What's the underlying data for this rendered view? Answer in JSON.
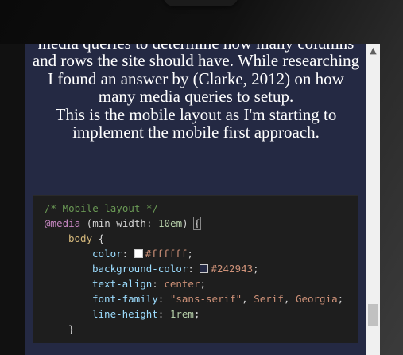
{
  "article": {
    "paragraph_1": "media queries to determine how many columns and rows the site should have. While researching I found an answer by (Clarke, 2012) on how many media queries to setup.",
    "paragraph_2": "This is the mobile layout as I'm starting to implement the mobile first approach."
  },
  "code": {
    "comment": "/* Mobile layout */",
    "at_rule": "@media",
    "condition_open": " (min-width: ",
    "min_width": "10em",
    "condition_close": ") ",
    "brace_open": "{",
    "selector": "body",
    "selector_brace": " {",
    "color_prop": "color",
    "color_value": "#ffffff",
    "color_swatch": "#ffffff",
    "bg_prop": "background-color",
    "bg_value": "#242943",
    "bg_swatch": "#242943",
    "align_prop": "text-align",
    "align_value": "center",
    "font_prop": "font-family",
    "font_value_1": "\"sans-serif\"",
    "font_value_2": "Serif",
    "font_value_3": "Georgia",
    "lh_prop": "line-height",
    "lh_value": "1rem",
    "brace_close": "}"
  },
  "colors": {
    "panel_bg": "#242943",
    "code_bg": "#1e1e1e"
  },
  "scrollbar": {
    "up_icon": "▲"
  }
}
